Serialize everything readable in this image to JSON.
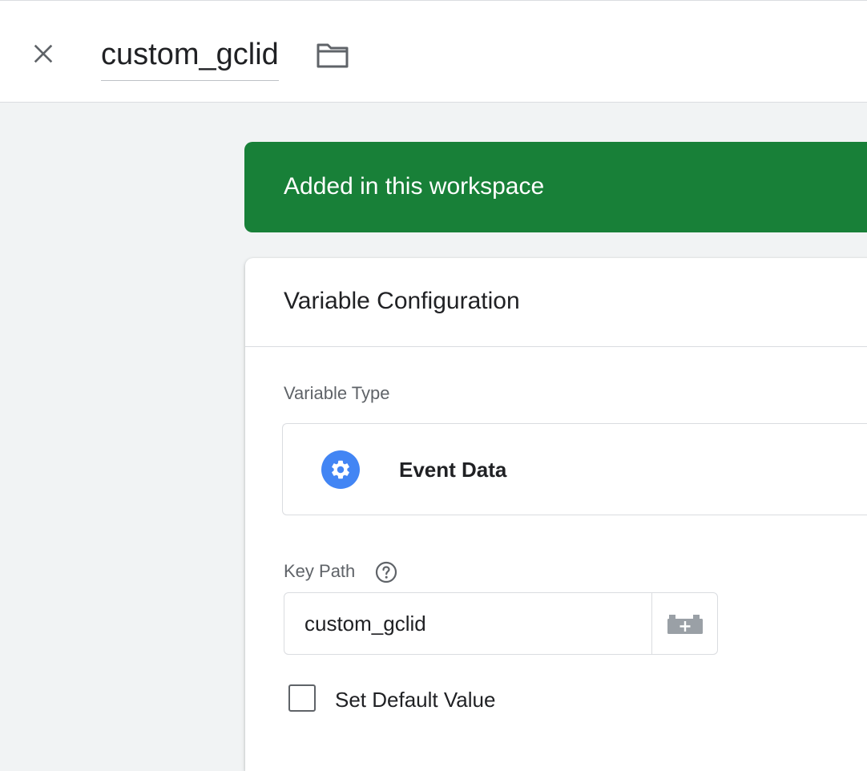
{
  "header": {
    "variable_name": "custom_gclid",
    "close_icon": "close-icon",
    "folder_icon": "folder-icon"
  },
  "banner": {
    "text": "Added in this workspace",
    "color": "#188038"
  },
  "config": {
    "title": "Variable Configuration",
    "variable_type_label": "Variable Type",
    "variable_type_value": "Event Data",
    "variable_type_icon": "gear-icon",
    "key_path_label": "Key Path",
    "key_path_value": "custom_gclid",
    "key_path_help_icon": "help-icon",
    "key_path_variable_icon": "add-variable-icon",
    "default_value_label": "Set Default Value",
    "default_value_checked": false
  },
  "colors": {
    "accent_blue": "#4285f4",
    "background": "#f1f3f4"
  }
}
